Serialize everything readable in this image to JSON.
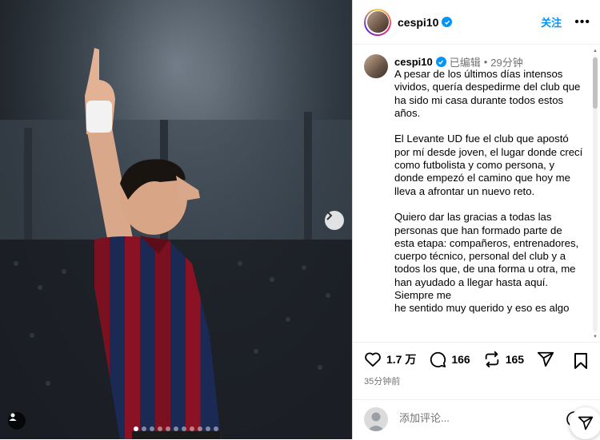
{
  "post": {
    "username": "cespi10",
    "follow_label": "关注",
    "more_label": "•••",
    "edited_label": "已编辑",
    "separator": "•",
    "time_ago": "29分钟",
    "caption": "A pesar de los últimos días intensos vividos, quería despedirme del club que ha sido mi casa durante todos estos años.\n\nEl Levante UD fue el club que apostó por mí desde joven, el lugar donde crecí como futbolista y como persona, y donde empezó el camino que hoy me lleva a afrontar un nuevo reto.\n\nQuiero dar las gracias a todas las personas que han formado parte de esta etapa: compañeros, entrenadores, cuerpo técnico, personal del club y a todos los que, de una forma u otra, me han ayudado a llegar hasta aquí. Siempre me\nhe sentido muy querido y eso es algo",
    "likes": "1.7 万",
    "comments": "166",
    "reposts": "165",
    "posted_ago": "35分钟前",
    "comment_placeholder": "添加评论..."
  },
  "carousel": {
    "total": 11,
    "active": 0
  },
  "colors": {
    "accent": "#0095f6",
    "muted": "#737373"
  }
}
